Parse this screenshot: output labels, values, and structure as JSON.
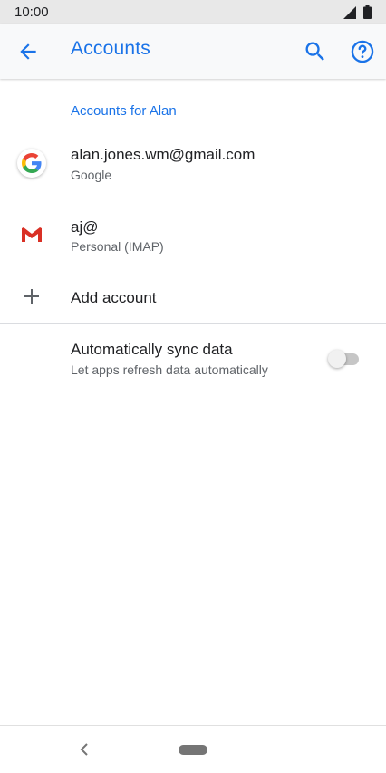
{
  "status_bar": {
    "time": "10:00",
    "icons": [
      "signal-icon",
      "battery-icon"
    ]
  },
  "app_bar": {
    "title": "Accounts",
    "icons": [
      "back-arrow-icon",
      "search-icon",
      "help-icon"
    ]
  },
  "accounts": {
    "section_header": "Accounts for Alan",
    "items": [
      {
        "title": "alan.jones.wm@gmail.com",
        "subtitle": "Google",
        "icon": "google-icon"
      },
      {
        "title": "aj@",
        "subtitle": "Personal (IMAP)",
        "icon": "gmail-icon"
      }
    ],
    "add_account_label": "Add account",
    "add_icon": "plus-icon"
  },
  "sync": {
    "title": "Automatically sync data",
    "subtitle": "Let apps refresh data automatically",
    "enabled": false
  },
  "nav_bar": {
    "icons": [
      "nav-back-icon",
      "home-pill"
    ]
  },
  "colors": {
    "accent": "#1a73e8",
    "gmail_red": "#d93025",
    "google_blue": "#4285f4",
    "google_red": "#ea4335",
    "google_yellow": "#fbbc05",
    "google_green": "#34a853"
  }
}
